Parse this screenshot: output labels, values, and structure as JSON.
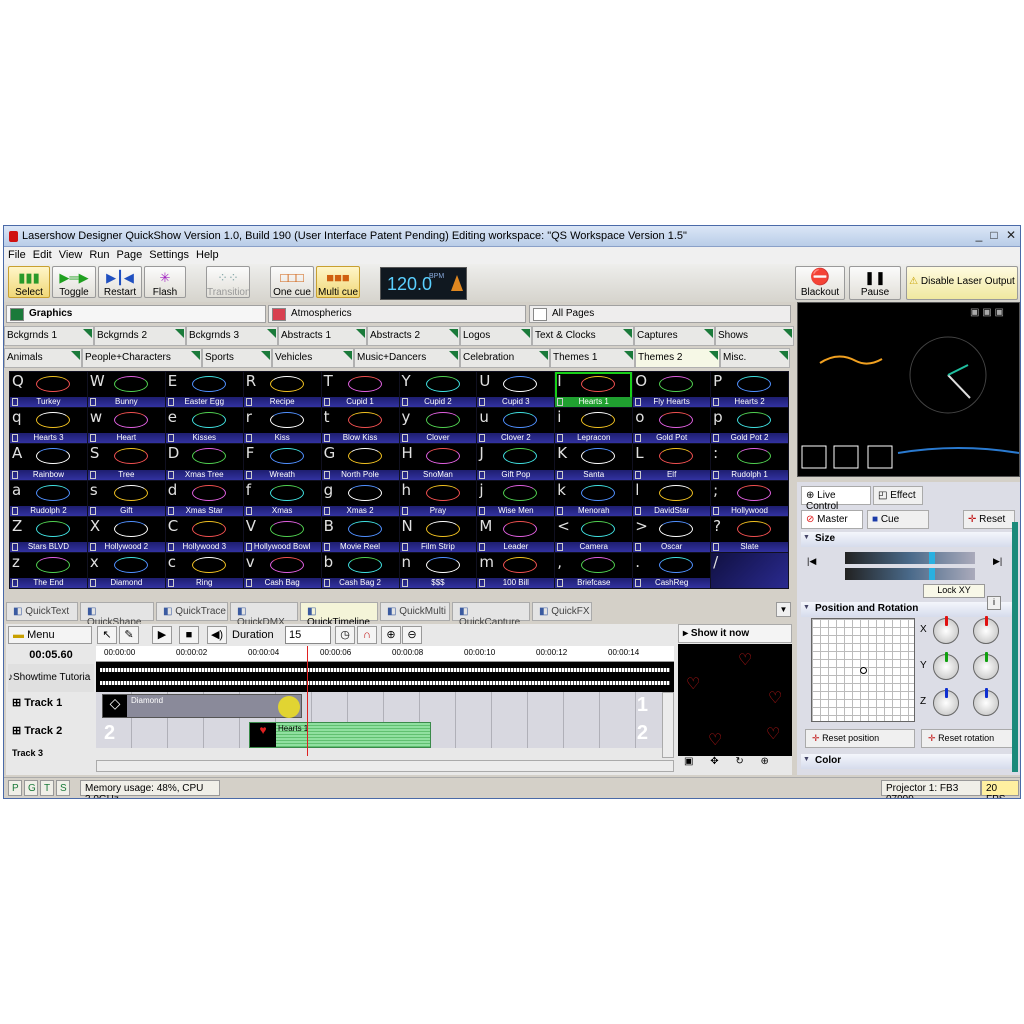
{
  "window": {
    "title": "Lasershow Designer QuickShow   Version 1.0, Build 190   (User Interface Patent Pending)   Editing workspace: \"QS Workspace Version 1.5\"",
    "min": "_",
    "max": "□",
    "close": "✕"
  },
  "menu": [
    "File",
    "Edit",
    "View",
    "Run",
    "Page",
    "Settings",
    "Help"
  ],
  "toolbar": {
    "select": "Select",
    "toggle": "Toggle",
    "restart": "Restart",
    "flash": "Flash",
    "transition": "Transition",
    "one_cue": "One cue",
    "multi_cue": "Multi cue",
    "bpm": "120.0",
    "bpm_unit": "BPM",
    "blackout": "Blackout",
    "pause": "Pause",
    "disable": "Disable Laser Output"
  },
  "categories": {
    "graphics": "Graphics",
    "atmospherics": "Atmospherics",
    "all_pages": "All Pages",
    "graphics_color": "#1a7a3a",
    "atmos_color": "#d84050"
  },
  "groups_row1": [
    "Bckgrnds 1",
    "Bckgrnds 2",
    "Bckgrnds 3",
    "Abstracts 1",
    "Abstracts 2",
    "Logos",
    "Text & Clocks",
    "Captures",
    "Shows"
  ],
  "groups_row2": [
    "Animals",
    "People+Characters",
    "Sports",
    "Vehicles",
    "Music+Dancers",
    "Celebration",
    "Themes 1",
    "Themes 2",
    "Misc."
  ],
  "cues": [
    {
      "k": "Q",
      "n": "Turkey"
    },
    {
      "k": "W",
      "n": "Bunny"
    },
    {
      "k": "E",
      "n": "Easter Egg"
    },
    {
      "k": "R",
      "n": "Recipe"
    },
    {
      "k": "T",
      "n": "Cupid 1"
    },
    {
      "k": "Y",
      "n": "Cupid 2"
    },
    {
      "k": "U",
      "n": "Cupid 3"
    },
    {
      "k": "I",
      "n": "Hearts 1"
    },
    {
      "k": "O",
      "n": "Fly Hearts"
    },
    {
      "k": "P",
      "n": "Hearts 2"
    },
    {
      "k": "q",
      "n": "Hearts 3"
    },
    {
      "k": "w",
      "n": "Heart"
    },
    {
      "k": "e",
      "n": "Kisses"
    },
    {
      "k": "r",
      "n": "Kiss"
    },
    {
      "k": "t",
      "n": "Blow Kiss"
    },
    {
      "k": "y",
      "n": "Clover"
    },
    {
      "k": "u",
      "n": "Clover 2"
    },
    {
      "k": "i",
      "n": "Lepracon"
    },
    {
      "k": "o",
      "n": "Gold Pot"
    },
    {
      "k": "p",
      "n": "Gold Pot 2"
    },
    {
      "k": "A",
      "n": "Rainbow"
    },
    {
      "k": "S",
      "n": "Tree"
    },
    {
      "k": "D",
      "n": "Xmas Tree"
    },
    {
      "k": "F",
      "n": "Wreath"
    },
    {
      "k": "G",
      "n": "North Pole"
    },
    {
      "k": "H",
      "n": "SnoMan"
    },
    {
      "k": "J",
      "n": "Gift Pop"
    },
    {
      "k": "K",
      "n": "Santa"
    },
    {
      "k": "L",
      "n": "Elf"
    },
    {
      "k": ":",
      "n": "Rudolph 1"
    },
    {
      "k": "a",
      "n": "Rudolph 2"
    },
    {
      "k": "s",
      "n": "Gift"
    },
    {
      "k": "d",
      "n": "Xmas Star"
    },
    {
      "k": "f",
      "n": "Xmas"
    },
    {
      "k": "g",
      "n": "Xmas 2"
    },
    {
      "k": "h",
      "n": "Pray"
    },
    {
      "k": "j",
      "n": "Wise Men"
    },
    {
      "k": "k",
      "n": "Menorah"
    },
    {
      "k": "l",
      "n": "DavidStar"
    },
    {
      "k": ";",
      "n": "Hollywood"
    },
    {
      "k": "Z",
      "n": "Stars BLVD"
    },
    {
      "k": "X",
      "n": "Hollywood 2"
    },
    {
      "k": "C",
      "n": "Hollywood 3"
    },
    {
      "k": "V",
      "n": "Hollywood Bowl"
    },
    {
      "k": "B",
      "n": "Movie Reel"
    },
    {
      "k": "N",
      "n": "Film Strip"
    },
    {
      "k": "M",
      "n": "Leader"
    },
    {
      "k": "<",
      "n": "Camera"
    },
    {
      "k": ">",
      "n": "Oscar"
    },
    {
      "k": "?",
      "n": "Slate"
    },
    {
      "k": "z",
      "n": "The End"
    },
    {
      "k": "x",
      "n": "Diamond"
    },
    {
      "k": "c",
      "n": "Ring"
    },
    {
      "k": "v",
      "n": "Cash Bag"
    },
    {
      "k": "b",
      "n": "Cash Bag 2"
    },
    {
      "k": "n",
      "n": "$$$"
    },
    {
      "k": "m",
      "n": "100 Bill"
    },
    {
      "k": ",",
      "n": "Briefcase"
    },
    {
      "k": ".",
      "n": "CashReg"
    },
    {
      "k": "/",
      "n": ""
    }
  ],
  "bottom_tabs": [
    "QuickText",
    "QuickShape",
    "QuickTrace",
    "QuickDMX",
    "QuickTimeline",
    "QuickMulti",
    "QuickCapture",
    "QuickFX"
  ],
  "timeline": {
    "menu": "Menu",
    "duration_label": "Duration",
    "duration": "15",
    "time": "00:05.60",
    "showtime": "Showtime Tutoria",
    "ruler": [
      "00:00:00",
      "00:00:02",
      "00:00:04",
      "00:00:06",
      "00:00:08",
      "00:00:10",
      "00:00:12",
      "00:00:14"
    ],
    "track1": "Track 1",
    "track2": "Track 2",
    "track3": "Track 3",
    "clip1": "Diamond",
    "clip2": "Hearts 1",
    "num1": "1",
    "num2": "2",
    "show_it_now": "Show it now"
  },
  "control": {
    "live": "Live Control",
    "effect": "Effect",
    "master": "Master",
    "cue": "Cue",
    "reset": "Reset",
    "size": "Size",
    "lock_xy": "Lock XY",
    "pos_rot": "Position and Rotation",
    "x": "X",
    "y": "Y",
    "z": "Z",
    "reset_pos": "Reset position",
    "reset_rot": "Reset rotation",
    "color": "Color"
  },
  "status": {
    "p": "P",
    "g": "G",
    "t": "T",
    "s": "S",
    "memory": "Memory usage: 48%, CPU 3.0GHz",
    "projector": "Projector 1: FB3 07999",
    "fps": "20 FPS"
  }
}
